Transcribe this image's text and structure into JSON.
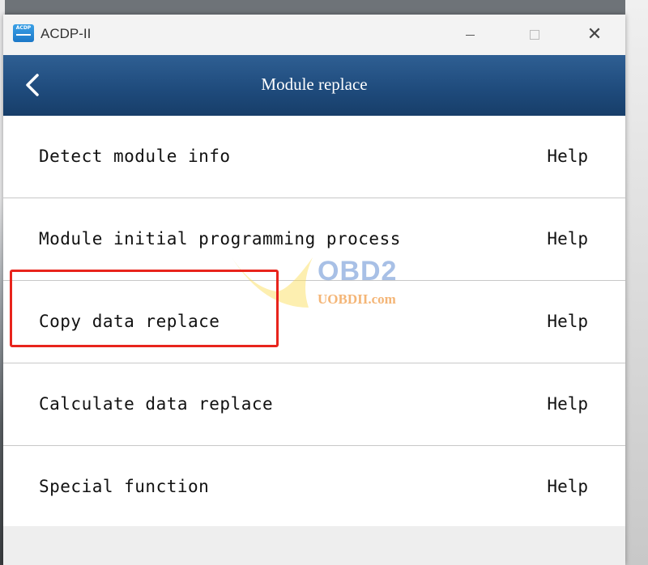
{
  "window": {
    "app_title": "ACDP-II",
    "icon_text": "ACDP"
  },
  "header": {
    "title": "Module replace"
  },
  "menu": {
    "items": [
      {
        "label": "Detect module info",
        "help": "Help"
      },
      {
        "label": "Module initial programming process",
        "help": "Help"
      },
      {
        "label": "Copy data replace",
        "help": "Help"
      },
      {
        "label": "Calculate data replace",
        "help": "Help"
      },
      {
        "label": "Special function",
        "help": "Help"
      }
    ],
    "highlighted_index": 2
  },
  "watermark": {
    "brand": "OBD2",
    "site": "UOBDII.com"
  },
  "colors": {
    "header_bg": "#1e4a7b",
    "highlight": "#e8241c"
  }
}
